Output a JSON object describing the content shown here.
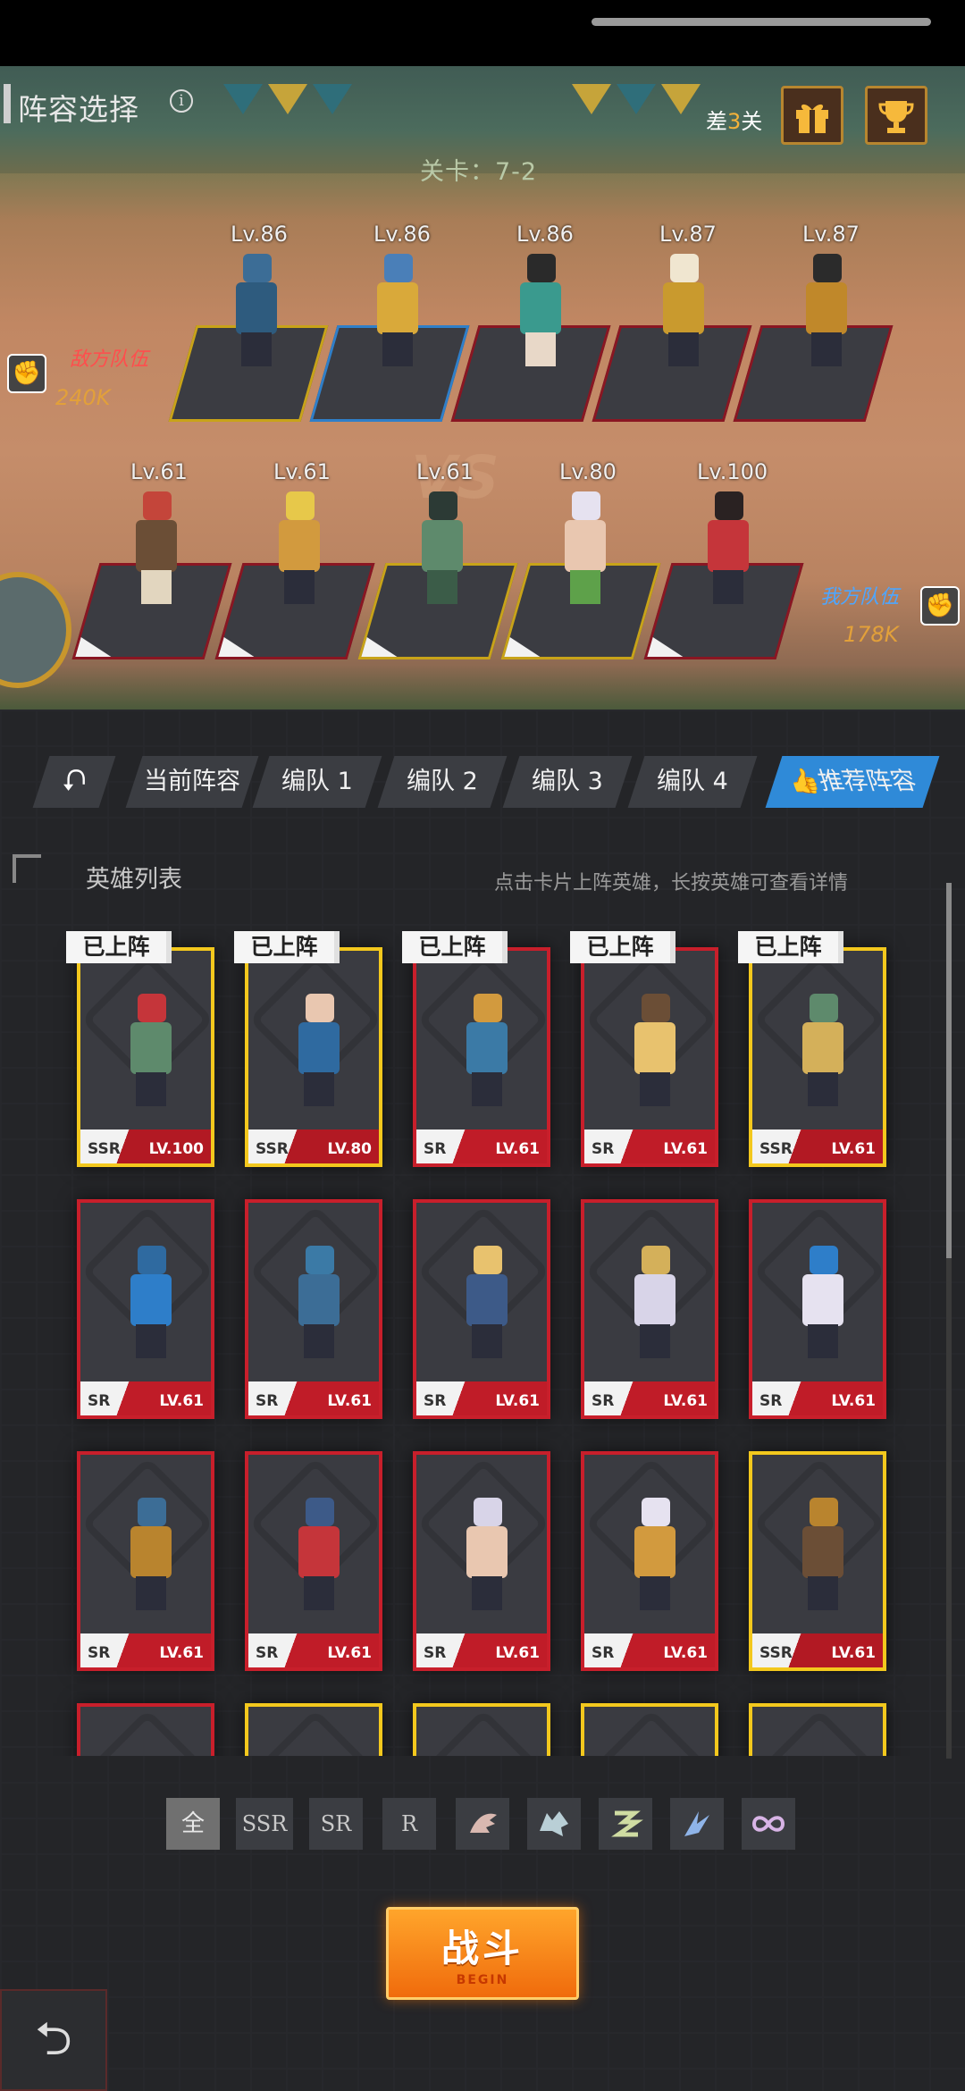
{
  "header": {
    "title": "阵容选择",
    "info_icon": "i",
    "gap_prefix": "差",
    "gap_number": "3",
    "gap_suffix": "关",
    "gift_icon": "gift-icon",
    "trophy_icon": "trophy-icon"
  },
  "battlefield": {
    "stage": "关卡：7-2",
    "vs": "VS",
    "enemy": {
      "label": "敌方队伍",
      "power": "240K",
      "levels": [
        "Lv.86",
        "Lv.86",
        "Lv.86",
        "Lv.87",
        "Lv.87"
      ]
    },
    "mine": {
      "label": "我方队伍",
      "power": "178K",
      "levels": [
        "Lv.61",
        "Lv.61",
        "Lv.61",
        "Lv.80",
        "Lv.100"
      ]
    }
  },
  "tabs": [
    "当前阵容",
    "编队 1",
    "编队 2",
    "编队 3",
    "编队 4",
    "推荐阵容"
  ],
  "hero_list": {
    "title": "英雄列表",
    "hint": "点击卡片上阵英雄，长按英雄可查看详情",
    "deployed_label": "已上阵",
    "cards": [
      {
        "rarity": "SSR",
        "level": "100",
        "deployed": true
      },
      {
        "rarity": "SSR",
        "level": "80",
        "deployed": true
      },
      {
        "rarity": "SR",
        "level": "61",
        "deployed": true
      },
      {
        "rarity": "SR",
        "level": "61",
        "deployed": true
      },
      {
        "rarity": "SSR",
        "level": "61",
        "deployed": true
      },
      {
        "rarity": "SR",
        "level": "61",
        "deployed": false
      },
      {
        "rarity": "SR",
        "level": "61",
        "deployed": false
      },
      {
        "rarity": "SR",
        "level": "61",
        "deployed": false
      },
      {
        "rarity": "SR",
        "level": "61",
        "deployed": false
      },
      {
        "rarity": "SR",
        "level": "61",
        "deployed": false
      },
      {
        "rarity": "SR",
        "level": "61",
        "deployed": false
      },
      {
        "rarity": "SR",
        "level": "61",
        "deployed": false
      },
      {
        "rarity": "SR",
        "level": "61",
        "deployed": false
      },
      {
        "rarity": "SR",
        "level": "61",
        "deployed": false
      },
      {
        "rarity": "SSR",
        "level": "61",
        "deployed": false
      }
    ]
  },
  "filters": [
    "全",
    "SSR",
    "SR",
    "R"
  ],
  "faction_icons": [
    "faction-claw-icon",
    "faction-wolf-icon",
    "faction-serpent-icon",
    "faction-feather-icon",
    "faction-infinity-icon"
  ],
  "fight_button": {
    "label": "战斗",
    "sub": "BEGIN"
  },
  "lv_prefix": "LV."
}
